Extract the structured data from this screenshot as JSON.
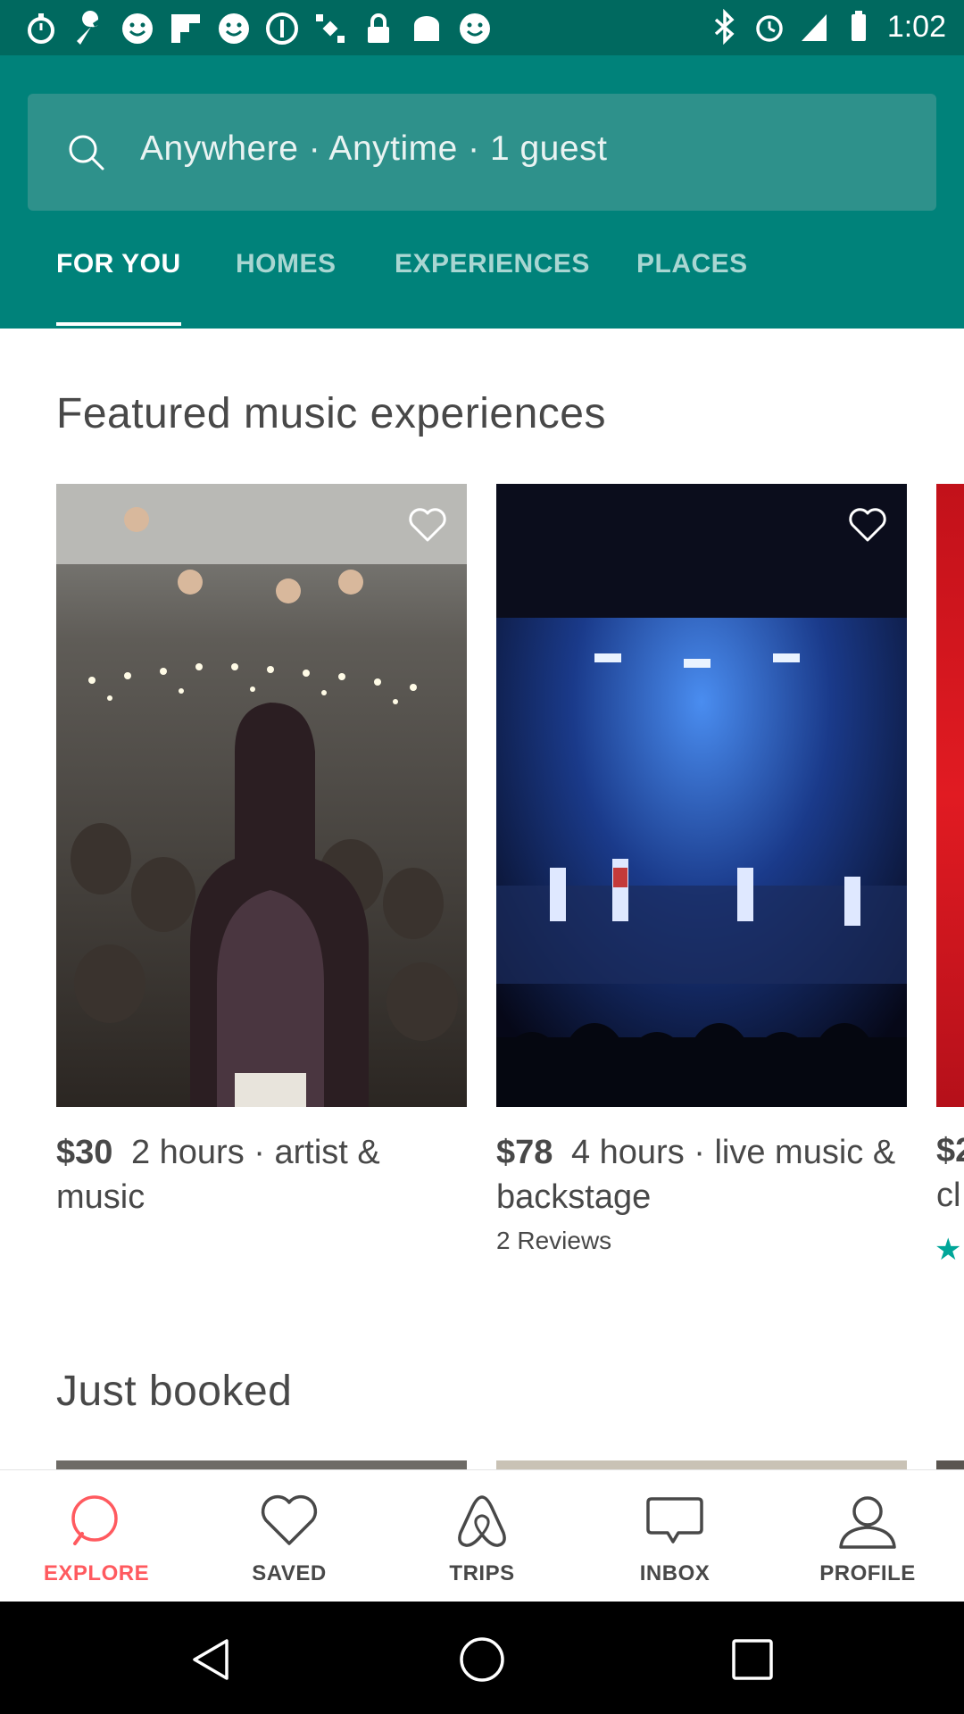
{
  "status_bar": {
    "time": "1:02",
    "icons": [
      "stopwatch-icon",
      "wrench-icon",
      "smiley-icon",
      "flipboard-icon",
      "smiley-icon",
      "smiley-icon",
      "circle-icon",
      "satellite-icon",
      "lock-icon",
      "toast-icon",
      "smiley-icon",
      "bluetooth-icon",
      "alarm-icon",
      "signal-icon",
      "battery-icon"
    ]
  },
  "search": {
    "text": "Anywhere · Anytime · 1 guest",
    "icon": "search-icon"
  },
  "tabs": [
    {
      "label": "FOR YOU",
      "active": true
    },
    {
      "label": "HOMES",
      "active": false
    },
    {
      "label": "EXPERIENCES",
      "active": false
    },
    {
      "label": "PLACES",
      "active": false
    }
  ],
  "featured": {
    "title": "Featured music experiences",
    "cards": [
      {
        "price": "$30",
        "description": "2 hours · artist & music",
        "reviews": ""
      },
      {
        "price": "$78",
        "description": "4 hours · live music & backstage",
        "reviews": "2 Reviews"
      }
    ],
    "peek_price": "$2",
    "peek_text": "cl"
  },
  "just_booked": {
    "title": "Just booked"
  },
  "bottom_nav": [
    {
      "label": "EXPLORE",
      "icon": "search-icon",
      "active": true
    },
    {
      "label": "SAVED",
      "icon": "heart-icon",
      "active": false
    },
    {
      "label": "TRIPS",
      "icon": "airbnb-logo-icon",
      "active": false
    },
    {
      "label": "INBOX",
      "icon": "chat-bubble-icon",
      "active": false
    },
    {
      "label": "PROFILE",
      "icon": "person-icon",
      "active": false
    }
  ],
  "colors": {
    "header": "#00827a",
    "status_bar": "#00695f",
    "accent": "#ff5a5f",
    "teal_star": "#00a699"
  }
}
